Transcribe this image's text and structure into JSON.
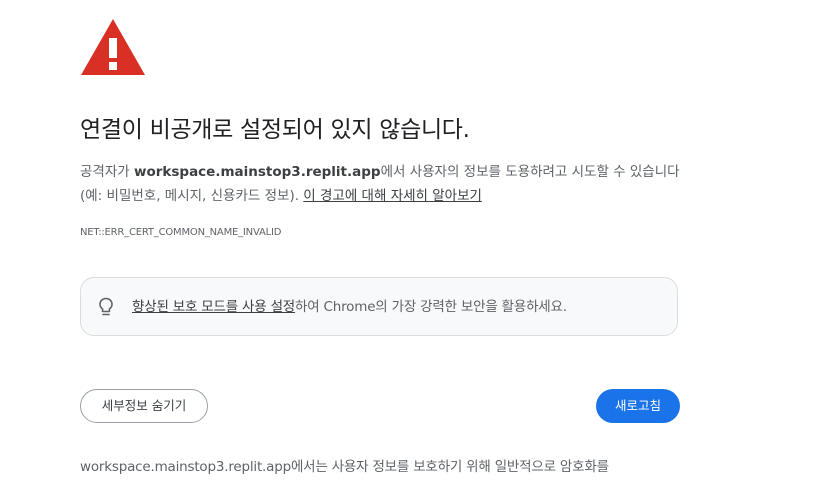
{
  "icons": {
    "warning": "warning-triangle-icon",
    "bulb": "lightbulb-icon"
  },
  "colors": {
    "warning_red": "#d93025",
    "primary_blue": "#1a73e8",
    "text_secondary": "#5f6368"
  },
  "main": {
    "title": "연결이 비공개로 설정되어 있지 않습니다.",
    "desc_prefix": "공격자가 ",
    "desc_host": "workspace.mainstop3.replit.app",
    "desc_suffix": "에서 사용자의 정보를 도용하려고 시도할 수 있습니다(예: 비밀번호, 메시지, 신용카드 정보). ",
    "learn_more_link": "이 경고에 대해 자세히 알아보기",
    "error_code": "NET::ERR_CERT_COMMON_NAME_INVALID"
  },
  "enhanced": {
    "link": "향상된 보호 모드를 사용 설정",
    "suffix": "하여 Chrome의 가장 강력한 보안을 활용하세요."
  },
  "buttons": {
    "hide_details": "세부정보 숨기기",
    "reload": "새로고침"
  },
  "details": {
    "text": "workspace.mainstop3.replit.app에서는 사용자 정보를 보호하기 위해 일반적으로 암호화를"
  }
}
